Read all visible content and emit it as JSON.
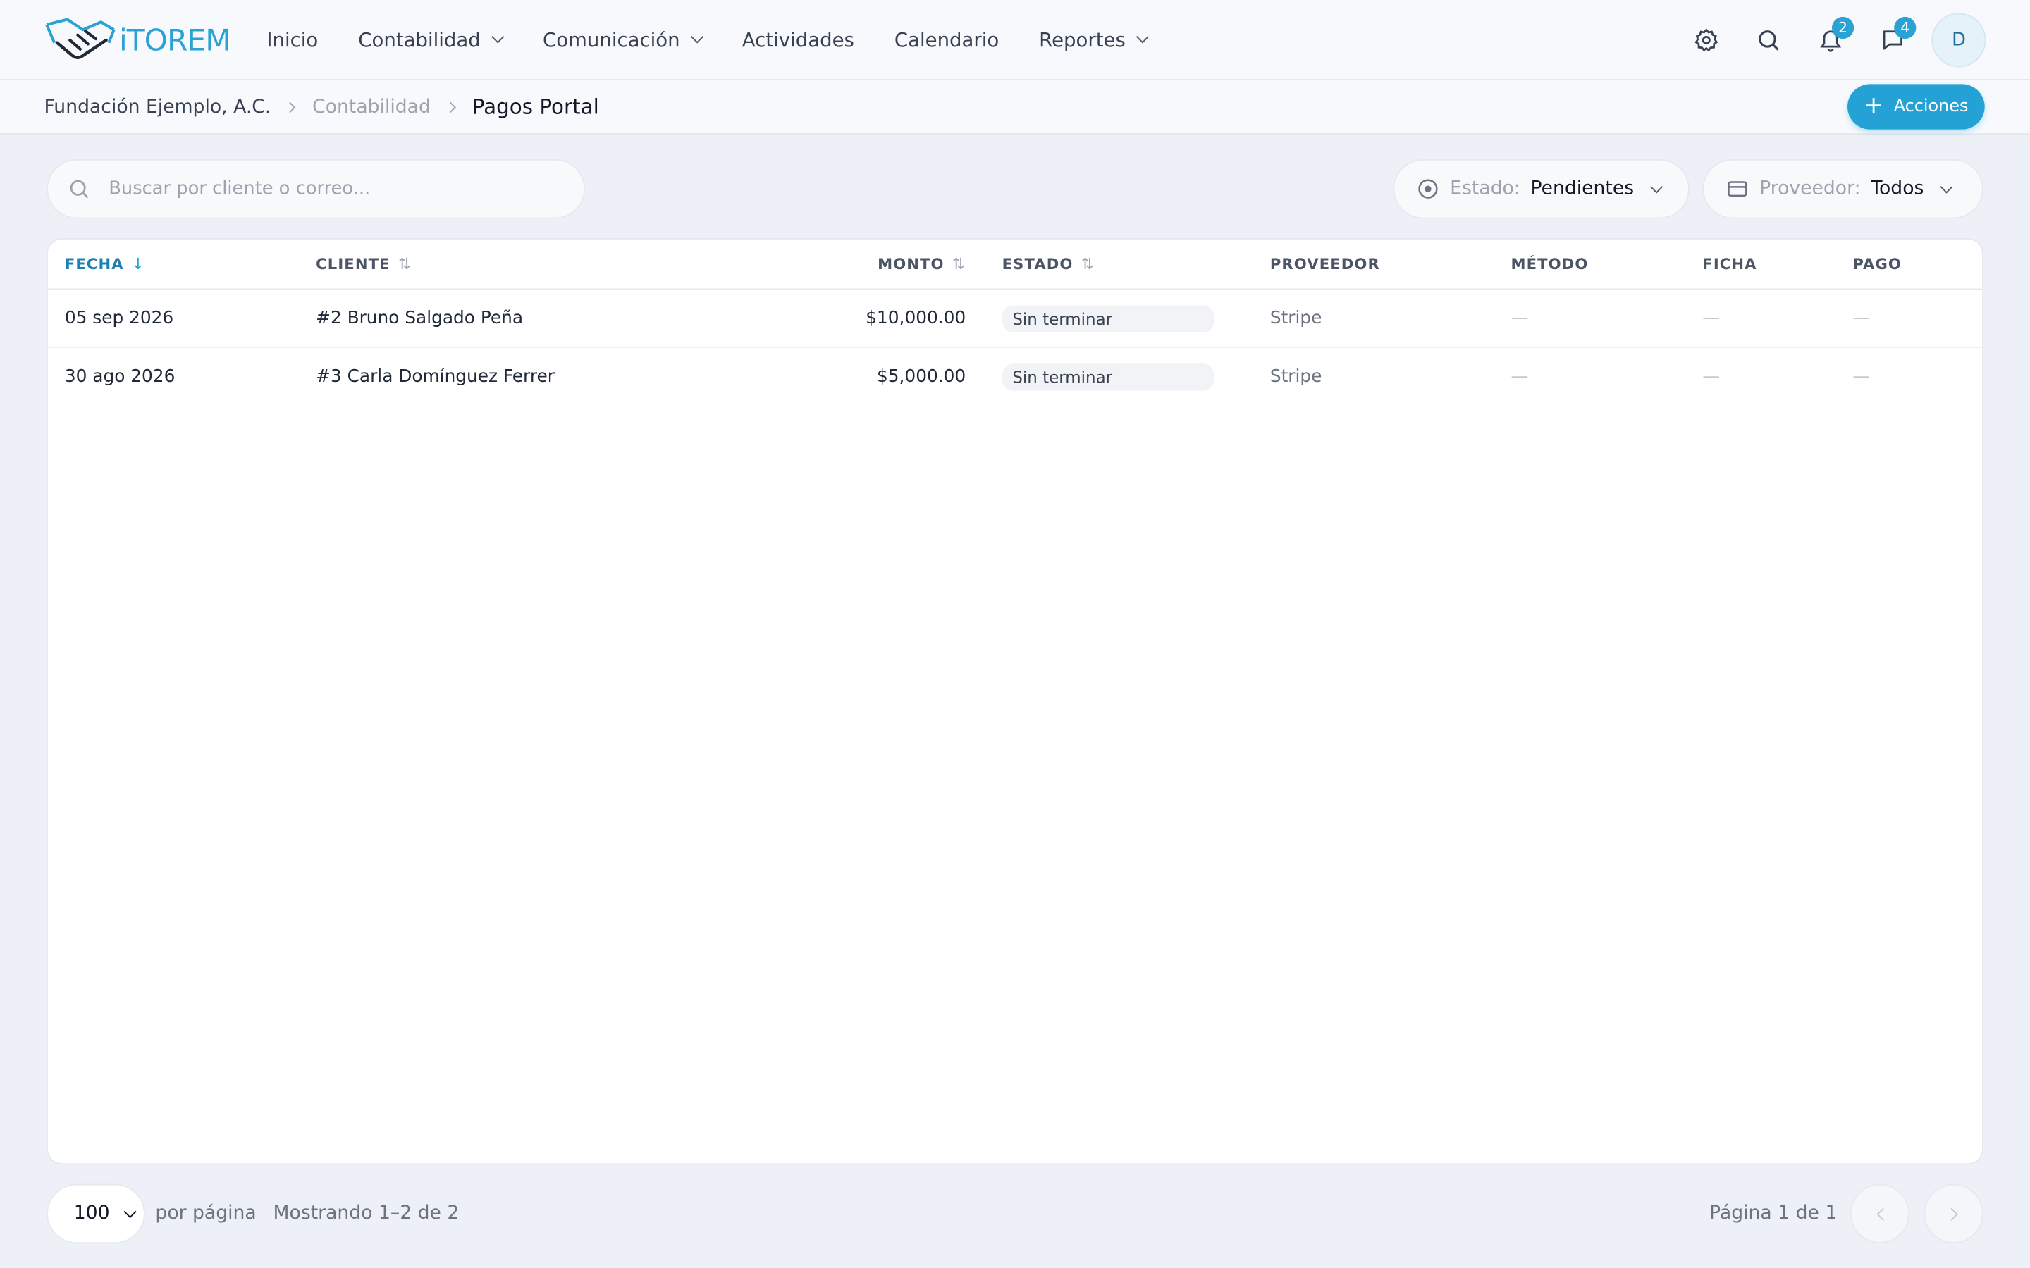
{
  "brand": {
    "name": "iTOREM",
    "color": "#2aa3d4",
    "icon": "handshake-icon"
  },
  "nav": {
    "items": [
      {
        "label": "Inicio",
        "dropdown": false
      },
      {
        "label": "Contabilidad",
        "dropdown": true
      },
      {
        "label": "Comunicación",
        "dropdown": true
      },
      {
        "label": "Actividades",
        "dropdown": false
      },
      {
        "label": "Calendario",
        "dropdown": false
      },
      {
        "label": "Reportes",
        "dropdown": true
      }
    ]
  },
  "header_icons": {
    "settings": "gear-icon",
    "search": "search-icon",
    "notifications": {
      "icon": "bell-icon",
      "count": "2"
    },
    "messages": {
      "icon": "chat-icon",
      "count": "4"
    },
    "avatar_initial": "D"
  },
  "breadcrumb": {
    "org": "Fundación Ejemplo, A.C.",
    "section": "Contabilidad",
    "page": "Pagos Portal"
  },
  "actions_button": {
    "label": "Acciones"
  },
  "search": {
    "placeholder": "Buscar por cliente o correo...",
    "value": ""
  },
  "filters": {
    "estado": {
      "label": "Estado:",
      "value": "Pendientes"
    },
    "proveedor": {
      "label": "Proveedor:",
      "value": "Todos"
    }
  },
  "table": {
    "columns": [
      "FECHA",
      "CLIENTE",
      "MONTO",
      "ESTADO",
      "PROVEEDOR",
      "MÉTODO",
      "FICHA",
      "PAGO"
    ],
    "rows": [
      {
        "fecha": "05 sep 2026",
        "cliente": "#2 Bruno Salgado Peña",
        "monto": "$10,000.00",
        "estado": "Sin terminar",
        "proveedor": "Stripe",
        "metodo": "—",
        "ficha": "—",
        "pago": "—"
      },
      {
        "fecha": "30 ago 2026",
        "cliente": "#3 Carla Domínguez Ferrer",
        "monto": "$5,000.00",
        "estado": "Sin terminar",
        "proveedor": "Stripe",
        "metodo": "—",
        "ficha": "—",
        "pago": "—"
      }
    ]
  },
  "footer": {
    "per_page_value": "100",
    "per_page_label": "por página",
    "showing": "Mostrando 1–2 de 2",
    "page_info": "Página 1 de 1"
  },
  "colors": {
    "accent": "#24a2d6",
    "background": "#edf1f7"
  }
}
